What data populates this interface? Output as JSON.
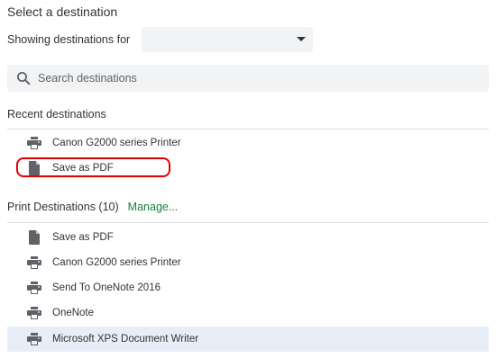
{
  "header": {
    "title": "Select a destination"
  },
  "filter": {
    "label": "Showing destinations for",
    "selected_value": ""
  },
  "search": {
    "placeholder": "Search destinations"
  },
  "recent": {
    "heading": "Recent destinations",
    "items": [
      {
        "label": "Canon G2000 series Printer",
        "icon": "printer-icon"
      },
      {
        "label": "Save as PDF",
        "icon": "pdf-file-icon"
      }
    ]
  },
  "print_destinations": {
    "heading": "Print Destinations (10)",
    "manage_label": "Manage...",
    "items": [
      {
        "label": "Save as PDF",
        "icon": "pdf-file-icon"
      },
      {
        "label": "Canon G2000 series Printer",
        "icon": "printer-icon"
      },
      {
        "label": "Send To OneNote 2016",
        "icon": "printer-icon"
      },
      {
        "label": "OneNote",
        "icon": "printer-icon"
      },
      {
        "label": "Microsoft XPS Document Writer",
        "icon": "printer-icon"
      }
    ]
  },
  "colors": {
    "accent_link": "#188038",
    "highlight_row": "#e8eef7",
    "annotation": "#e00000",
    "field_bg": "#f1f3f4",
    "icon": "#5f6368"
  }
}
